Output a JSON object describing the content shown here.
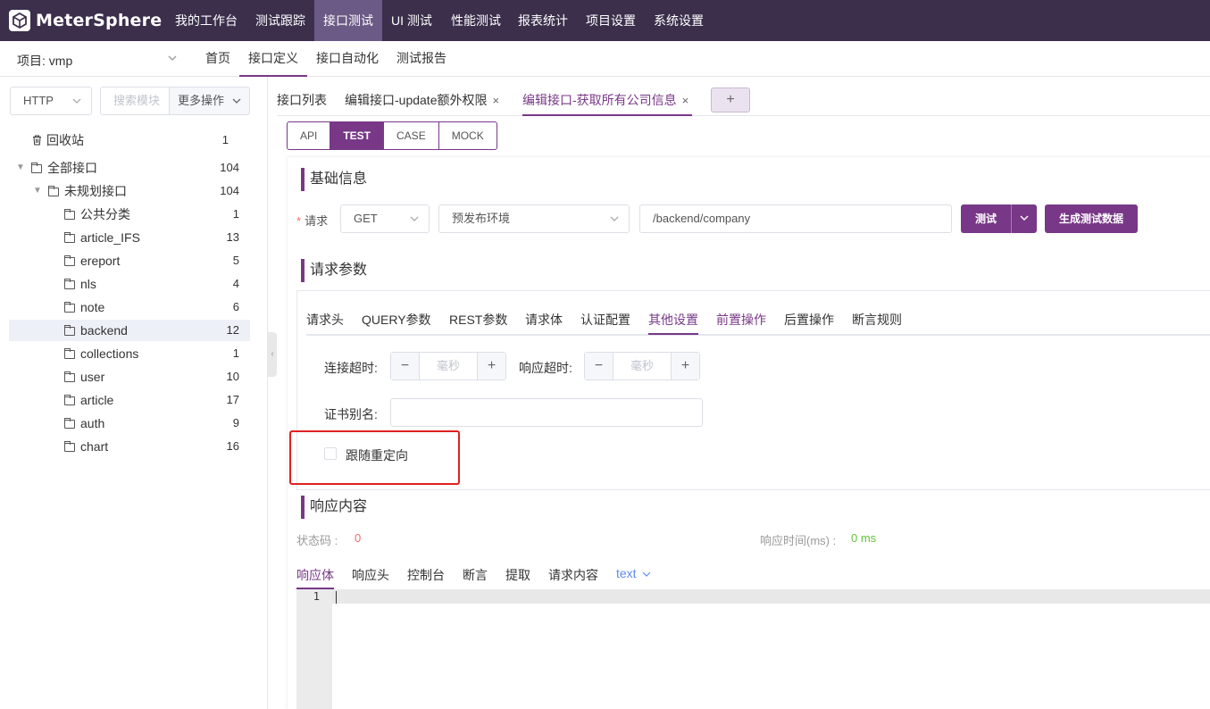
{
  "app": {
    "logo_text": "MeterSphere",
    "accent_color": "#783887",
    "topbar_color": "#3b2f4c"
  },
  "topnav": {
    "items": [
      "我的工作台",
      "测试跟踪",
      "接口测试",
      "UI 测试",
      "性能测试",
      "报表统计",
      "项目设置",
      "系统设置"
    ],
    "active": "接口测试"
  },
  "subnav": {
    "project_label": "项目: vmp",
    "items": [
      "首页",
      "接口定义",
      "接口自动化",
      "测试报告"
    ],
    "active": "接口定义"
  },
  "left": {
    "protocol": "HTTP",
    "search_placeholder": "搜索模块",
    "more_ops": "更多操作",
    "trash": {
      "label": "回收站",
      "count": "1"
    },
    "root": {
      "label": "全部接口",
      "count": "104"
    },
    "unplanned": {
      "label": "未规划接口",
      "count": "104"
    },
    "modules": [
      {
        "label": "公共分类",
        "count": "1"
      },
      {
        "label": "article_IFS",
        "count": "13"
      },
      {
        "label": "ereport",
        "count": "5"
      },
      {
        "label": "nls",
        "count": "4"
      },
      {
        "label": "note",
        "count": "6"
      },
      {
        "label": "backend",
        "count": "12"
      },
      {
        "label": "collections",
        "count": "1"
      },
      {
        "label": "user",
        "count": "10"
      },
      {
        "label": "article",
        "count": "17"
      },
      {
        "label": "auth",
        "count": "9"
      },
      {
        "label": "chart",
        "count": "16"
      }
    ]
  },
  "tabs": {
    "list": "接口列表",
    "tab1": "编辑接口-update额外权限",
    "tab2": "编辑接口-获取所有公司信息",
    "add": "+",
    "close": "×"
  },
  "modes": {
    "items": [
      "API",
      "TEST",
      "CASE",
      "MOCK"
    ],
    "active": "TEST"
  },
  "basic": {
    "title": "基础信息",
    "request_label": "请求",
    "method": "GET",
    "env": "预发布环境",
    "path": "/backend/company",
    "test_btn": "测试",
    "gen_btn": "生成测试数据"
  },
  "params": {
    "title": "请求参数",
    "tabs": [
      "请求头",
      "QUERY参数",
      "REST参数",
      "请求体",
      "认证配置",
      "其他设置",
      "前置操作",
      "后置操作",
      "断言规则"
    ],
    "active": "其他设置",
    "connect_timeout_label": "连接超时:",
    "response_timeout_label": "响应超时:",
    "ms_placeholder": "毫秒",
    "cert_alias_label": "证书别名:",
    "cert_alias_value": "",
    "follow_redirect_label": "跟随重定向",
    "follow_redirect_checked": false
  },
  "response": {
    "title": "响应内容",
    "status_label": "状态码 :",
    "status_value": "0",
    "time_label": "响应时间(ms) :",
    "time_value": "0 ms",
    "tabs": [
      "响应体",
      "响应头",
      "控制台",
      "断言",
      "提取",
      "请求内容"
    ],
    "active": "响应体",
    "format": "text",
    "line_number": "1"
  }
}
